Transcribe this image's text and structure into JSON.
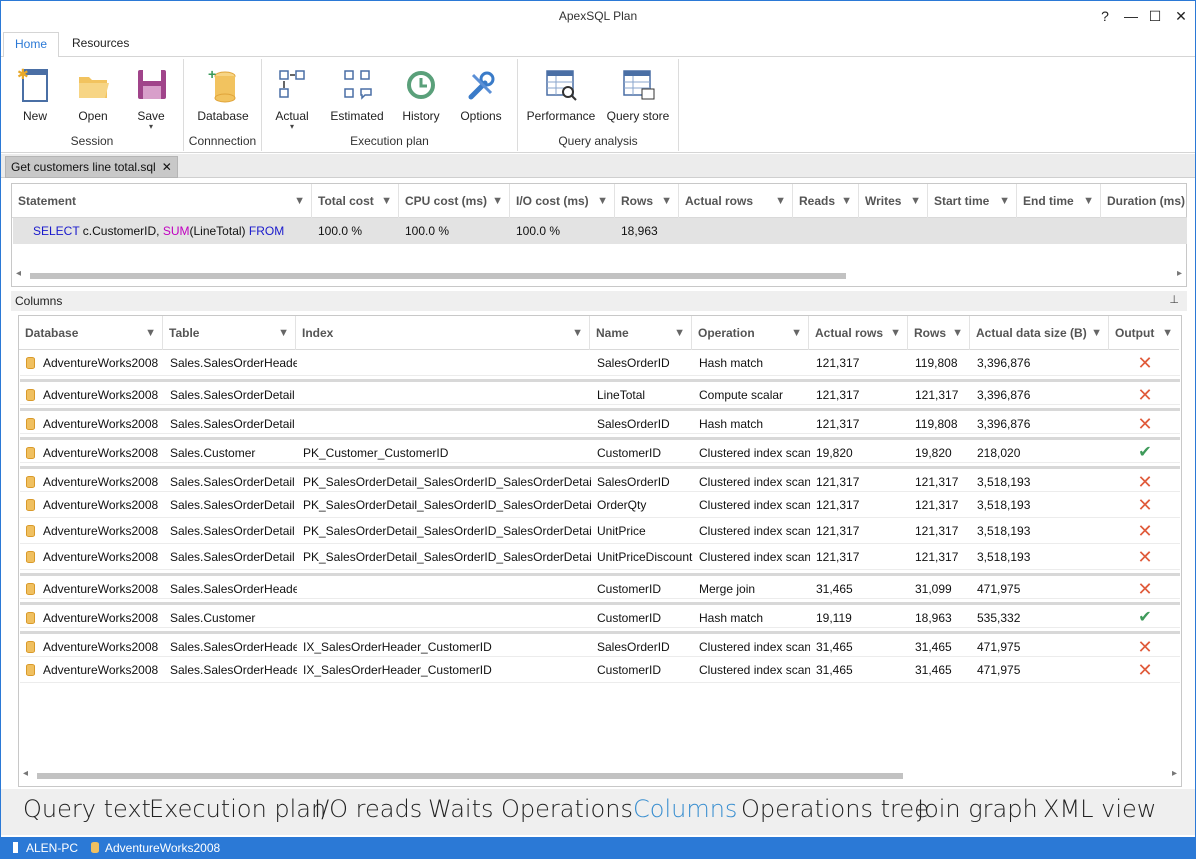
{
  "window": {
    "title": "ApexSQL Plan",
    "help": "?",
    "minimize": "—",
    "maximize": "☐",
    "close": "✕"
  },
  "ribbon": {
    "tabs": [
      "Home",
      "Resources"
    ],
    "groups": {
      "session": {
        "label": "Session",
        "new": "New",
        "open": "Open",
        "save": "Save"
      },
      "connection": {
        "label": "Connnection",
        "database": "Database"
      },
      "execution_plan": {
        "label": "Execution plan",
        "actual": "Actual",
        "estimated": "Estimated",
        "history": "History",
        "options": "Options"
      },
      "query_analysis": {
        "label": "Query analysis",
        "performance": "Performance",
        "query_store": "Query store"
      }
    },
    "drop_glyph": "▾"
  },
  "doc_tab": {
    "label": "Get customers line total.sql",
    "close": "✕"
  },
  "statement_grid": {
    "columns": [
      "Statement",
      "Total cost",
      "CPU cost (ms)",
      "I/O cost (ms)",
      "Rows",
      "Actual rows",
      "Reads",
      "Writes",
      "Start time",
      "End time",
      "Duration (ms)"
    ],
    "row": {
      "stmt_select": "SELECT",
      "stmt_part1": " c.CustomerID, ",
      "stmt_sum": "SUM",
      "stmt_part2": "(LineTotal) ",
      "stmt_from": "FROM",
      "total_cost": "100.0 %",
      "cpu_cost": "100.0 %",
      "io_cost": "100.0 %",
      "rows": "18,963",
      "actual_rows": "",
      "reads": "",
      "writes": "",
      "start_time": "",
      "end_time": "",
      "duration": ""
    }
  },
  "columns_panel": {
    "title": "Columns",
    "pin": "📌",
    "headers": [
      "Database",
      "Table",
      "Index",
      "Name",
      "Operation",
      "Actual rows",
      "Rows",
      "Actual data size (B)",
      "Output"
    ],
    "rows": [
      {
        "database": "AdventureWorks2008",
        "table": "Sales.SalesOrderHeader",
        "index": "",
        "name": "SalesOrderID",
        "operation": "Hash match",
        "actual_rows": "121,317",
        "rows": "119,808",
        "size": "3,396,876",
        "output": "✕"
      },
      {
        "database": "AdventureWorks2008",
        "table": "Sales.SalesOrderDetail",
        "index": "",
        "name": "LineTotal",
        "operation": "Compute scalar",
        "actual_rows": "121,317",
        "rows": "121,317",
        "size": "3,396,876",
        "output": "✕"
      },
      {
        "database": "AdventureWorks2008",
        "table": "Sales.SalesOrderDetail",
        "index": "",
        "name": "SalesOrderID",
        "operation": "Hash match",
        "actual_rows": "121,317",
        "rows": "119,808",
        "size": "3,396,876",
        "output": "✕"
      },
      {
        "database": "AdventureWorks2008",
        "table": "Sales.Customer",
        "index": "PK_Customer_CustomerID",
        "name": "CustomerID",
        "operation": "Clustered index scan",
        "actual_rows": "19,820",
        "rows": "19,820",
        "size": "218,020",
        "output": "✔"
      },
      {
        "database": "AdventureWorks2008",
        "table": "Sales.SalesOrderDetail",
        "index": "PK_SalesOrderDetail_SalesOrderID_SalesOrderDetailID",
        "name": "SalesOrderID",
        "operation": "Clustered index scan",
        "actual_rows": "121,317",
        "rows": "121,317",
        "size": "3,518,193",
        "output": "✕"
      },
      {
        "database": "AdventureWorks2008",
        "table": "Sales.SalesOrderDetail",
        "index": "PK_SalesOrderDetail_SalesOrderID_SalesOrderDetailID",
        "name": "OrderQty",
        "operation": "Clustered index scan",
        "actual_rows": "121,317",
        "rows": "121,317",
        "size": "3,518,193",
        "output": "✕"
      },
      {
        "database": "AdventureWorks2008",
        "table": "Sales.SalesOrderDetail",
        "index": "PK_SalesOrderDetail_SalesOrderID_SalesOrderDetailID",
        "name": "UnitPrice",
        "operation": "Clustered index scan",
        "actual_rows": "121,317",
        "rows": "121,317",
        "size": "3,518,193",
        "output": "✕"
      },
      {
        "database": "AdventureWorks2008",
        "table": "Sales.SalesOrderDetail",
        "index": "PK_SalesOrderDetail_SalesOrderID_SalesOrderDetailID",
        "name": "UnitPriceDiscount",
        "operation": "Clustered index scan",
        "actual_rows": "121,317",
        "rows": "121,317",
        "size": "3,518,193",
        "output": "✕"
      },
      {
        "database": "AdventureWorks2008",
        "table": "Sales.SalesOrderHeader",
        "index": "",
        "name": "CustomerID",
        "operation": "Merge join",
        "actual_rows": "31,465",
        "rows": "31,099",
        "size": "471,975",
        "output": "✕"
      },
      {
        "database": "AdventureWorks2008",
        "table": "Sales.Customer",
        "index": "",
        "name": "CustomerID",
        "operation": "Hash match",
        "actual_rows": "19,119",
        "rows": "18,963",
        "size": "535,332",
        "output": "✔"
      },
      {
        "database": "AdventureWorks2008",
        "table": "Sales.SalesOrderHeader",
        "index": "IX_SalesOrderHeader_CustomerID",
        "name": "SalesOrderID",
        "operation": "Clustered index scan",
        "actual_rows": "31,465",
        "rows": "31,465",
        "size": "471,975",
        "output": "✕"
      },
      {
        "database": "AdventureWorks2008",
        "table": "Sales.SalesOrderHeader",
        "index": "IX_SalesOrderHeader_CustomerID",
        "name": "CustomerID",
        "operation": "Clustered index scan",
        "actual_rows": "31,465",
        "rows": "31,465",
        "size": "471,975",
        "output": "✕"
      }
    ]
  },
  "bottom_tabs": [
    "Query text",
    "Execution plan",
    "I/O reads",
    "Waits",
    "Operations",
    "Columns",
    "Operations tree",
    "Join graph",
    "XML view"
  ],
  "active_bottom_tab": "Columns",
  "status": {
    "machine": "ALEN-PC",
    "database": "AdventureWorks2008"
  },
  "colors": {
    "accent": "#2b79d6",
    "active_tab": "#3a8fd0",
    "error": "#e05a3a",
    "ok": "#3e9a5a"
  }
}
